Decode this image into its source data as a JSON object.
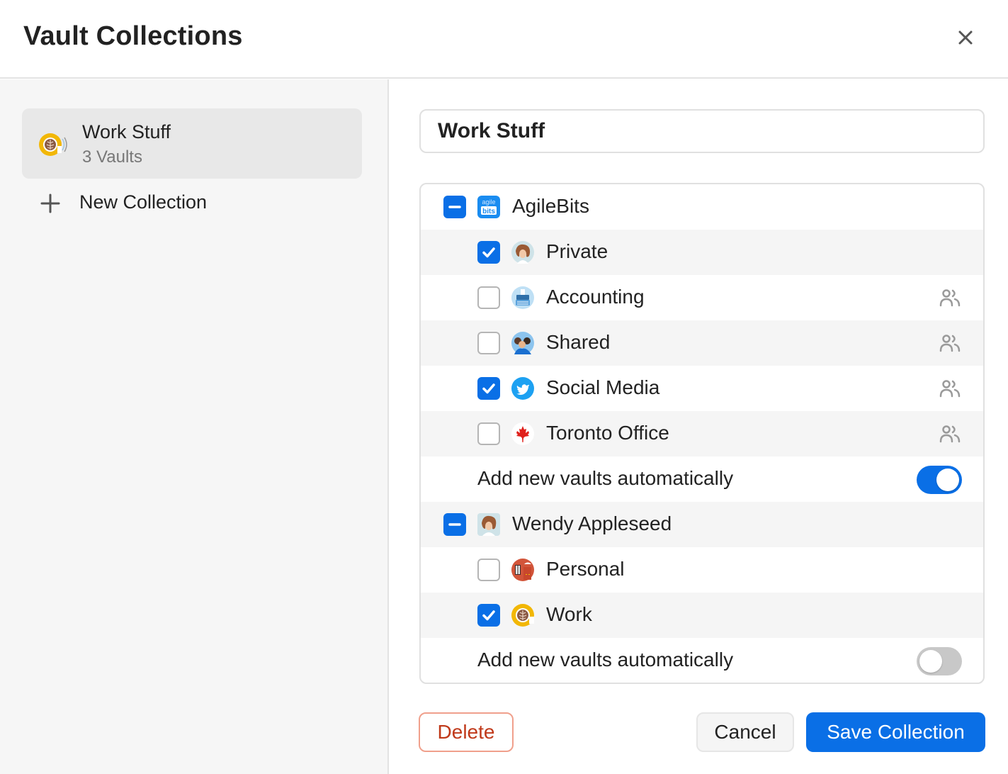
{
  "dialog": {
    "title": "Vault Collections",
    "close_icon": "close-icon"
  },
  "sidebar": {
    "collections": [
      {
        "name": "Work Stuff",
        "subtitle": "3 Vaults",
        "icon": "latte-art-icon",
        "selected": true
      }
    ],
    "new_collection_label": "New Collection"
  },
  "editor": {
    "collection_name_value": "Work Stuff",
    "groups": [
      {
        "name": "AgileBits",
        "icon": "agilebits-logo-icon",
        "state": "indeterminate",
        "vaults": [
          {
            "name": "Private",
            "icon": "user-photo-icon",
            "checked": true,
            "shared": false
          },
          {
            "name": "Accounting",
            "icon": "typewriter-icon",
            "checked": false,
            "shared": true
          },
          {
            "name": "Shared",
            "icon": "group-people-icon",
            "checked": false,
            "shared": true
          },
          {
            "name": "Social Media",
            "icon": "twitter-bird-icon",
            "checked": true,
            "shared": true
          },
          {
            "name": "Toronto Office",
            "icon": "maple-leaf-icon",
            "checked": false,
            "shared": true
          }
        ],
        "auto_add_label": "Add new vaults automatically",
        "auto_add": true
      },
      {
        "name": "Wendy Appleseed",
        "icon": "user-photo-icon",
        "state": "indeterminate",
        "vaults": [
          {
            "name": "Personal",
            "icon": "house-icon",
            "checked": false,
            "shared": false
          },
          {
            "name": "Work",
            "icon": "latte-art-icon",
            "checked": true,
            "shared": false
          }
        ],
        "auto_add_label": "Add new vaults automatically",
        "auto_add": false
      }
    ]
  },
  "footer": {
    "delete_label": "Delete",
    "cancel_label": "Cancel",
    "save_label": "Save Collection"
  },
  "colors": {
    "accent": "#0a6fe6",
    "danger": "#c0391a",
    "danger_border": "#f0a08c"
  }
}
